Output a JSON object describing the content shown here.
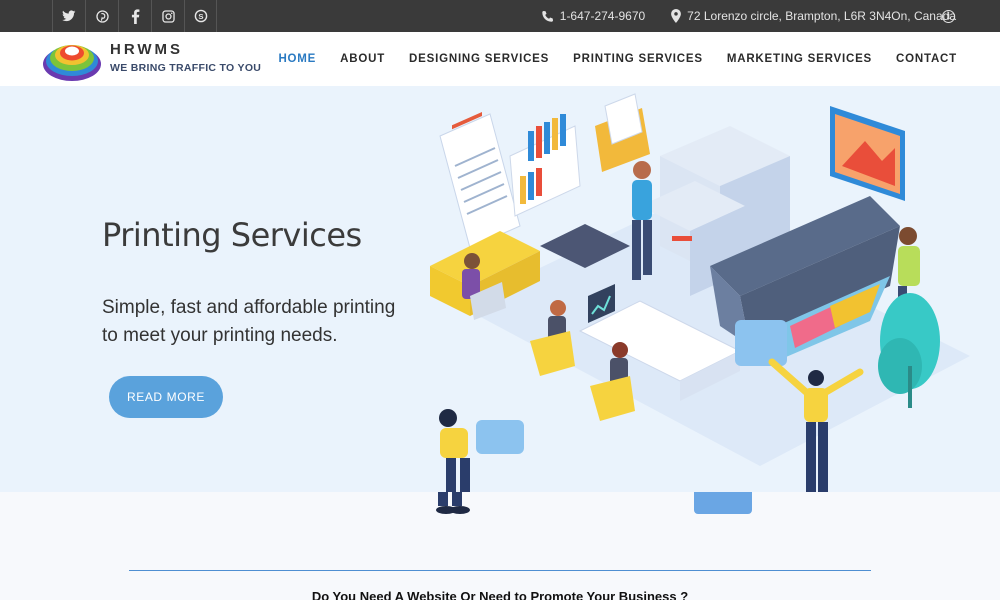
{
  "topbar": {
    "social": [
      {
        "icon": "twitter-icon",
        "glyph": "t"
      },
      {
        "icon": "pinterest-icon",
        "glyph": "p"
      },
      {
        "icon": "facebook-icon",
        "glyph": "f"
      },
      {
        "icon": "instagram-icon",
        "glyph": "◘"
      },
      {
        "icon": "skype-icon",
        "glyph": "S"
      }
    ],
    "phone": "1-647-274-9670",
    "address": "72 Lorenzo circle, Brampton, L6R 3N4On, Canada"
  },
  "header": {
    "logo_name": "HRWMS",
    "logo_tagline": "WE BRING TRAFFIC TO YOU",
    "nav": [
      {
        "label": "HOME",
        "active": true
      },
      {
        "label": "ABOUT",
        "active": false
      },
      {
        "label": "DESIGNING SERVICES",
        "active": false
      },
      {
        "label": "PRINTING SERVICES",
        "active": false
      },
      {
        "label": "MARKETING SERVICES",
        "active": false
      },
      {
        "label": "CONTACT",
        "active": false
      }
    ]
  },
  "hero": {
    "title": "Printing Services",
    "subtitle_line1": "Simple, fast and affordable printing",
    "subtitle_line2": "to meet your printing needs.",
    "button_label": "READ MORE"
  },
  "lower": {
    "cta_text": "Do You Need A Website Or Need to Promote Your Business ?"
  },
  "colors": {
    "accent": "#2a7ac2",
    "button": "#5aa2dc",
    "topbar": "#3a3a3a",
    "hero_bg": "#eaf3fc"
  }
}
